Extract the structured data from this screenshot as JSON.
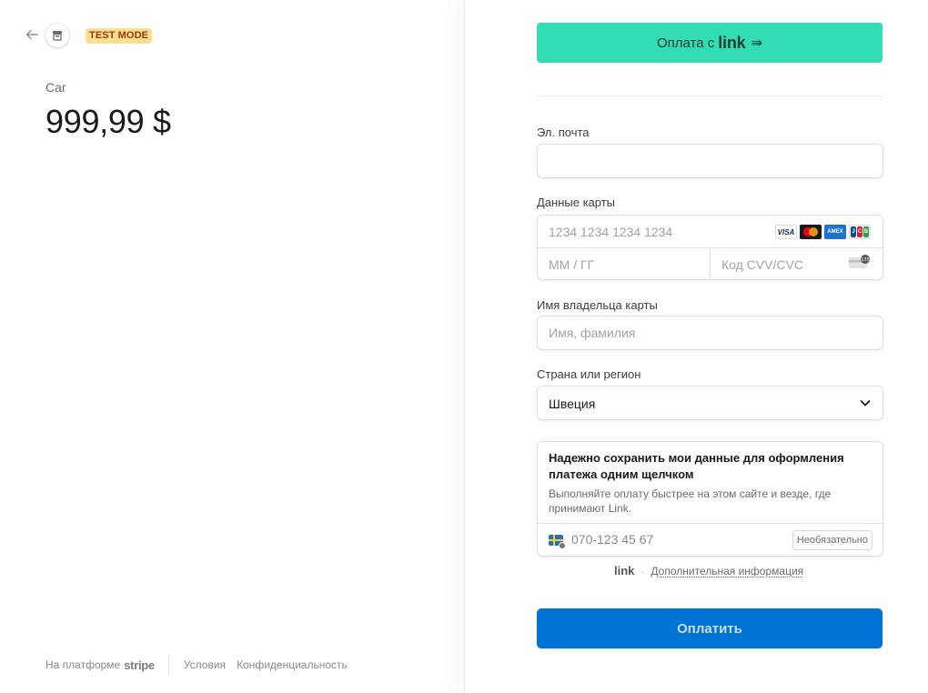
{
  "header": {
    "test_mode": "TEST MODE"
  },
  "product": {
    "name": "Car",
    "price": "999,99 $"
  },
  "footer": {
    "powered_by": "На платформе",
    "brand": "stripe",
    "terms": "Условия",
    "privacy": "Конфиденциальность"
  },
  "link_button": {
    "label": "Оплата с",
    "brand": "link",
    "arrow": "⇛"
  },
  "email": {
    "label": "Эл. почта",
    "value": ""
  },
  "card": {
    "label": "Данные карты",
    "number_placeholder": "1234 1234 1234 1234",
    "expiry_placeholder": "ММ / ГГ",
    "cvc_placeholder": "Код CVV/CVC",
    "brands": [
      "visa",
      "mastercard",
      "amex",
      "jcb"
    ]
  },
  "cardholder": {
    "label": "Имя владельца карты",
    "placeholder": "Имя, фамилия"
  },
  "country": {
    "label": "Страна или регион",
    "value": "Швеция"
  },
  "save_info": {
    "title": "Надежно сохранить мои данные для оформления платежа одним щелчком",
    "description": "Выполняйте оплату быстрее на этом сайте и везде, где принимают Link.",
    "phone_placeholder": "070-123 45 67",
    "optional": "Необязательно"
  },
  "link_info": {
    "brand": "link",
    "separator": "·",
    "more": "Дополнительная информация"
  },
  "pay_button": {
    "label": "Оплатить"
  },
  "colors": {
    "link_green": "#33ddb3",
    "pay_blue": "#0074d4",
    "test_badge": "#ffde92"
  }
}
